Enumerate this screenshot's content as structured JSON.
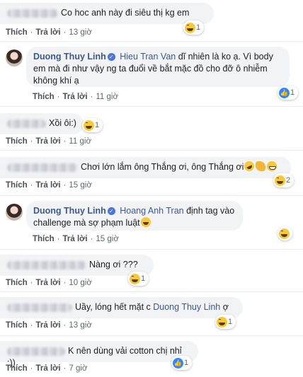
{
  "actions": {
    "like": "Thích",
    "reply": "Trả lời",
    "dot": "·"
  },
  "comments": [
    {
      "text": "Co hoc anh này đi siêu thị kg em",
      "time": "13 giờ",
      "react_count": "1"
    },
    {
      "author": "Duong Thuy Linh",
      "mention": "Hieu Tran Van",
      "text": " dĩ nhiên là ko ạ. Vì body em mà đi như vậy ng ta đuổi về bắt mặc đồ cho đỡ ô nhiễm không khí ạ",
      "time": "11 giờ",
      "react_count": "1"
    },
    {
      "text": "Xồi ôi:)",
      "time": "11 giờ",
      "react_count": "1"
    },
    {
      "text": "Chơi lớn lắm ông Thắng ơi, ông Thắng ơi",
      "time": "15 giờ",
      "react_count": "2"
    },
    {
      "author": "Duong Thuy Linh",
      "mention": "Hoang Anh Tran",
      "text": " định tag vào challenge mà sợ phạm luật",
      "time": "15 giờ",
      "react_count": ""
    },
    {
      "text": "Nàng ơi ???",
      "time": "10 giờ",
      "react_count": "1"
    },
    {
      "text": "Uầy, lóng hết mặt c ",
      "mention": "Duong Thuy Linh",
      "text_after": " ợ",
      "time": "13 giờ",
      "react_count": "1"
    },
    {
      "text": "K nên dùng vải cotton chị nhỉ :))",
      "time": "7 giờ",
      "react_count": "1"
    }
  ],
  "icons": [
    "haha-reaction-icon",
    "like-reaction-icon",
    "verified-badge-icon",
    "avatar"
  ]
}
